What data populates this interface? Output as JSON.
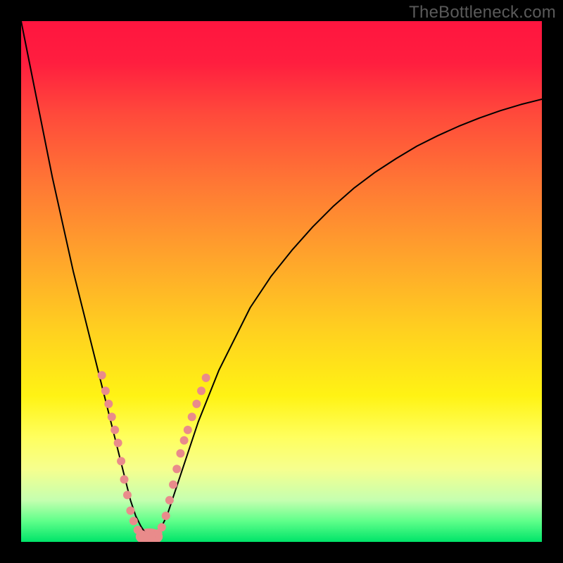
{
  "watermark": "TheBottleneck.com",
  "chart_data": {
    "type": "line",
    "title": "",
    "xlabel": "",
    "ylabel": "",
    "xlim": [
      0,
      100
    ],
    "ylim": [
      0,
      100
    ],
    "grid": false,
    "legend": false,
    "series": [
      {
        "name": "curve",
        "color": "#000000",
        "x": [
          0,
          2,
          4,
          6,
          8,
          10,
          12,
          14,
          16,
          18,
          19,
          20,
          21,
          22,
          23,
          24,
          25,
          26,
          27,
          28,
          29,
          30,
          32,
          34,
          36,
          38,
          40,
          44,
          48,
          52,
          56,
          60,
          64,
          68,
          72,
          76,
          80,
          84,
          88,
          92,
          96,
          100
        ],
        "y": [
          100,
          90,
          80,
          70,
          61,
          52,
          44,
          36,
          28,
          20,
          16,
          12,
          8,
          5,
          3,
          1.5,
          1,
          1.5,
          3,
          5,
          8,
          11,
          17,
          23,
          28,
          33,
          37,
          45,
          51,
          56,
          60.5,
          64.5,
          68,
          71,
          73.6,
          76,
          78,
          79.8,
          81.4,
          82.8,
          84,
          85
        ]
      }
    ],
    "scatter": [
      {
        "name": "dots",
        "color": "#e98b8b",
        "radius": 6,
        "points": [
          [
            15.5,
            32
          ],
          [
            16.2,
            29
          ],
          [
            16.8,
            26.5
          ],
          [
            17.4,
            24
          ],
          [
            18.0,
            21.5
          ],
          [
            18.6,
            19
          ],
          [
            19.2,
            15.5
          ],
          [
            19.8,
            12
          ],
          [
            20.4,
            9
          ],
          [
            21.0,
            6
          ],
          [
            21.6,
            4
          ],
          [
            22.4,
            2.3
          ],
          [
            23.3,
            1.4
          ],
          [
            24.3,
            1.0
          ],
          [
            25.3,
            1.0
          ],
          [
            26.3,
            1.6
          ],
          [
            27.0,
            2.8
          ],
          [
            27.8,
            5
          ],
          [
            28.5,
            8
          ],
          [
            29.2,
            11
          ],
          [
            29.9,
            14
          ],
          [
            30.6,
            17
          ],
          [
            31.3,
            19.5
          ],
          [
            32.0,
            21.5
          ],
          [
            32.8,
            24
          ],
          [
            33.7,
            26.5
          ],
          [
            34.6,
            29
          ],
          [
            35.5,
            31.5
          ]
        ]
      }
    ],
    "valley_pill": {
      "color": "#e98b8b",
      "cx": 24.6,
      "cy": 1.0,
      "rx": 2.6,
      "ry": 1.6
    }
  }
}
